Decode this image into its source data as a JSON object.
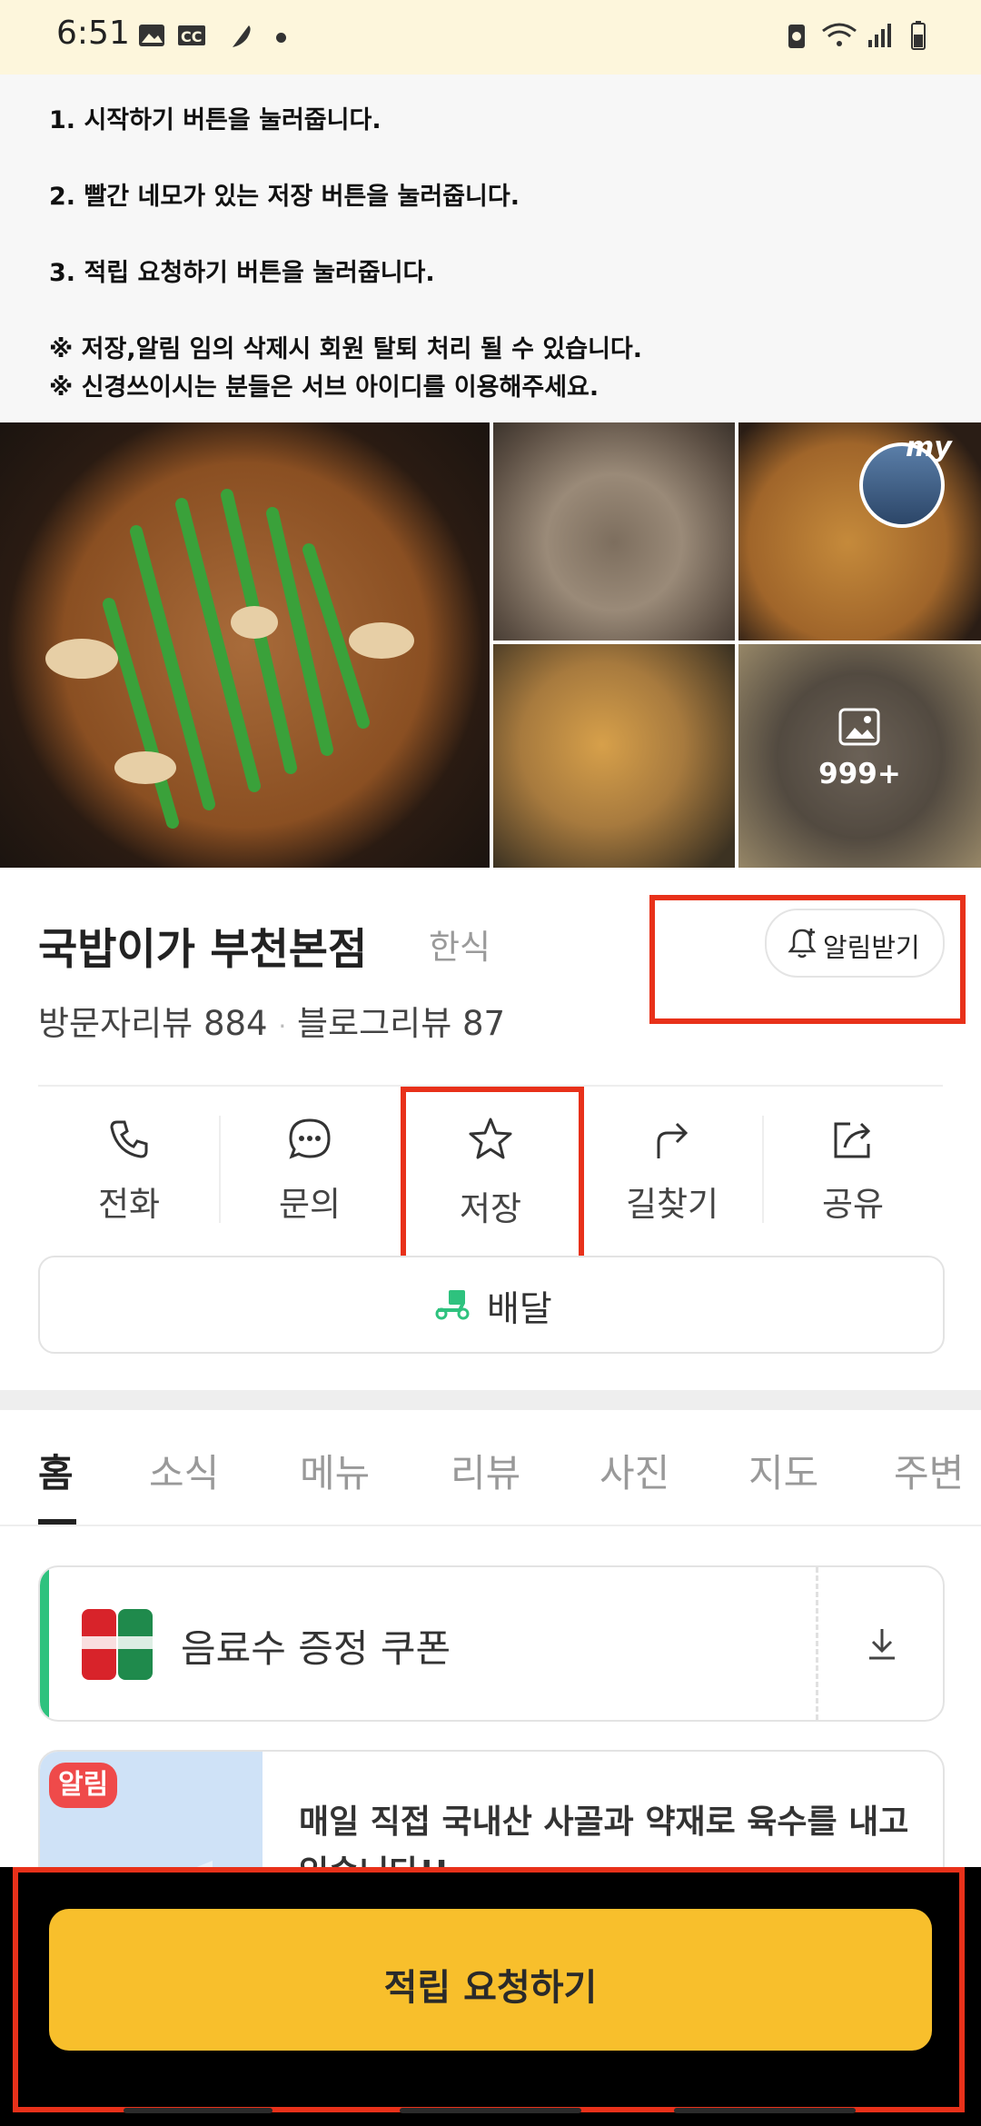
{
  "status_bar": {
    "time": "6:51"
  },
  "instructions": {
    "step1": "1. 시작하기 버튼을 눌러줍니다.",
    "step2": "2. 빨간 네모가 있는 저장 버튼을 눌러줍니다.",
    "step3": "3. 적립 요청하기 버튼을 눌러줍니다.",
    "note1": "※ 저장,알림 임의 삭제시 회원 탈퇴 처리 될 수 있습니다.",
    "note2": "※ 신경쓰이시는 분들은 서브 아이디를 이용해주세요."
  },
  "photos": {
    "count_label": "999+",
    "my_badge": "my"
  },
  "place": {
    "name": "국밥이가 부천본점",
    "category": "한식",
    "visitor_reviews": "방문자리뷰 884",
    "blog_reviews": "블로그리뷰 87",
    "separator": "·",
    "alarm_button": "알림받기"
  },
  "actions": [
    "전화",
    "문의",
    "저장",
    "길찾기",
    "공유"
  ],
  "delivery_button": "배달",
  "tabs": [
    "홈",
    "소식",
    "메뉴",
    "리뷰",
    "사진",
    "지도",
    "주변"
  ],
  "coupon": {
    "label": "음료수 증정 쿠폰"
  },
  "notice": {
    "badge": "알림",
    "text": "매일 직접 국내산 사골과 약재로 육수를 내고 있습니다!!"
  },
  "cta_button": "적립 요청하기",
  "colors": {
    "accent_yellow": "#f8bf2c",
    "highlight_red": "#e8311a",
    "coupon_green": "#2ec27e",
    "status_bg": "#fdf6dc"
  }
}
